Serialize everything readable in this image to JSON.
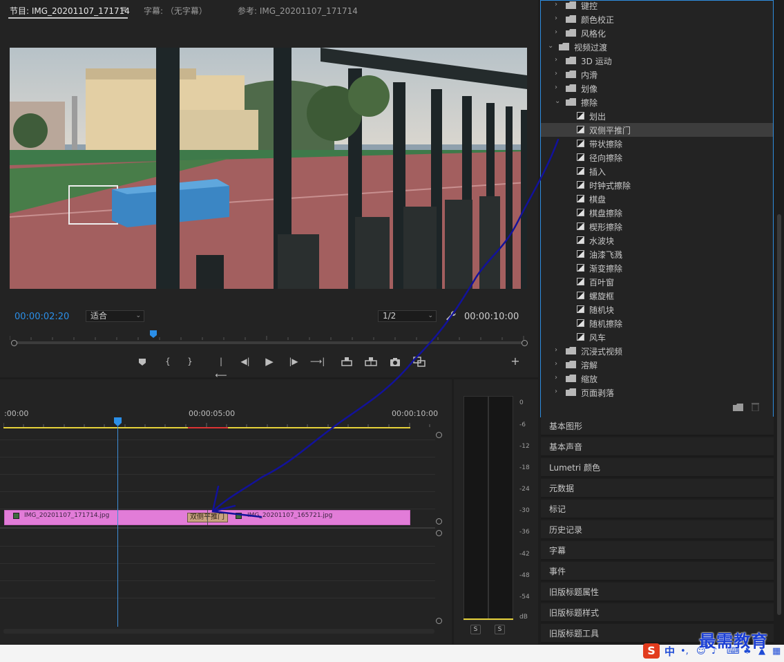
{
  "monitor": {
    "tabs": [
      {
        "label": "节目: IMG_20201107_171714"
      },
      {
        "label": "字幕: （无字幕）"
      },
      {
        "label": "参考: IMG_20201107_171714"
      }
    ],
    "tab_menu_icon": "hamburger-icon",
    "current_timecode": "00:00:02:20",
    "fit_label": "适合",
    "resolution_label": "1/2",
    "duration_timecode": "00:00:10:00",
    "transport_icons": [
      "marker-icon",
      "mark-in-icon",
      "mark-out-icon",
      "go-to-in-icon",
      "step-back-icon",
      "play-icon",
      "step-forward-icon",
      "go-to-out-icon",
      "lift-icon",
      "extract-icon",
      "export-frame-icon",
      "comparison-view-icon",
      "add-button-icon"
    ]
  },
  "timeline": {
    "time_labels": [
      ":00:00",
      "00:00:05:00",
      "00:00:10:00"
    ],
    "clip_a": "IMG_20201107_171714.jpg",
    "clip_b": "IMG_20201107_165721.jpg",
    "transition_label": "双侧平推门"
  },
  "meter": {
    "db_ticks": [
      "0",
      "-6",
      "-12",
      "-18",
      "-24",
      "-30",
      "-36",
      "-42",
      "-48",
      "-54",
      "dB"
    ],
    "solo_labels": [
      "S",
      "S"
    ]
  },
  "effects": {
    "tree": [
      {
        "label": "键控",
        "type": "folder",
        "level": 1,
        "expanded": false
      },
      {
        "label": "颜色校正",
        "type": "folder",
        "level": 1,
        "expanded": false
      },
      {
        "label": "风格化",
        "type": "folder",
        "level": 1,
        "expanded": false
      },
      {
        "label": "视频过渡",
        "type": "folder",
        "level": 0,
        "expanded": true
      },
      {
        "label": "3D 运动",
        "type": "folder",
        "level": 1,
        "expanded": false
      },
      {
        "label": "内滑",
        "type": "folder",
        "level": 1,
        "expanded": false
      },
      {
        "label": "划像",
        "type": "folder",
        "level": 1,
        "expanded": false
      },
      {
        "label": "擦除",
        "type": "folder",
        "level": 1,
        "expanded": true
      },
      {
        "label": "划出",
        "type": "preset",
        "level": 2
      },
      {
        "label": "双侧平推门",
        "type": "preset",
        "level": 2,
        "selected": true
      },
      {
        "label": "带状擦除",
        "type": "preset",
        "level": 2
      },
      {
        "label": "径向擦除",
        "type": "preset",
        "level": 2
      },
      {
        "label": "插入",
        "type": "preset",
        "level": 2
      },
      {
        "label": "时钟式擦除",
        "type": "preset",
        "level": 2
      },
      {
        "label": "棋盘",
        "type": "preset",
        "level": 2
      },
      {
        "label": "棋盘擦除",
        "type": "preset",
        "level": 2
      },
      {
        "label": "楔形擦除",
        "type": "preset",
        "level": 2
      },
      {
        "label": "水波块",
        "type": "preset",
        "level": 2
      },
      {
        "label": "油漆飞溅",
        "type": "preset",
        "level": 2
      },
      {
        "label": "渐变擦除",
        "type": "preset",
        "level": 2
      },
      {
        "label": "百叶窗",
        "type": "preset",
        "level": 2
      },
      {
        "label": "螺旋框",
        "type": "preset",
        "level": 2
      },
      {
        "label": "随机块",
        "type": "preset",
        "level": 2
      },
      {
        "label": "随机擦除",
        "type": "preset",
        "level": 2
      },
      {
        "label": "风车",
        "type": "preset",
        "level": 2
      },
      {
        "label": "沉浸式视频",
        "type": "folder",
        "level": 1,
        "expanded": false
      },
      {
        "label": "溶解",
        "type": "folder",
        "level": 1,
        "expanded": false
      },
      {
        "label": "缩放",
        "type": "folder",
        "level": 1,
        "expanded": false
      },
      {
        "label": "页面剥落",
        "type": "folder",
        "level": 1,
        "expanded": false
      }
    ]
  },
  "panels": [
    "基本图形",
    "基本声音",
    "Lumetri 颜色",
    "元数据",
    "标记",
    "历史记录",
    "字幕",
    "事件",
    "旧版标题属性",
    "旧版标题样式",
    "旧版标题工具"
  ],
  "watermark": "最需教育",
  "ime": {
    "logo": "S",
    "mode": "中"
  },
  "colors": {
    "accent_blue": "#2b8fe8",
    "clip_pink": "#e27cd8",
    "transition_tan": "#c9a380",
    "work_area_yellow": "#e6d23a",
    "annotation_blue": "#12129a"
  }
}
